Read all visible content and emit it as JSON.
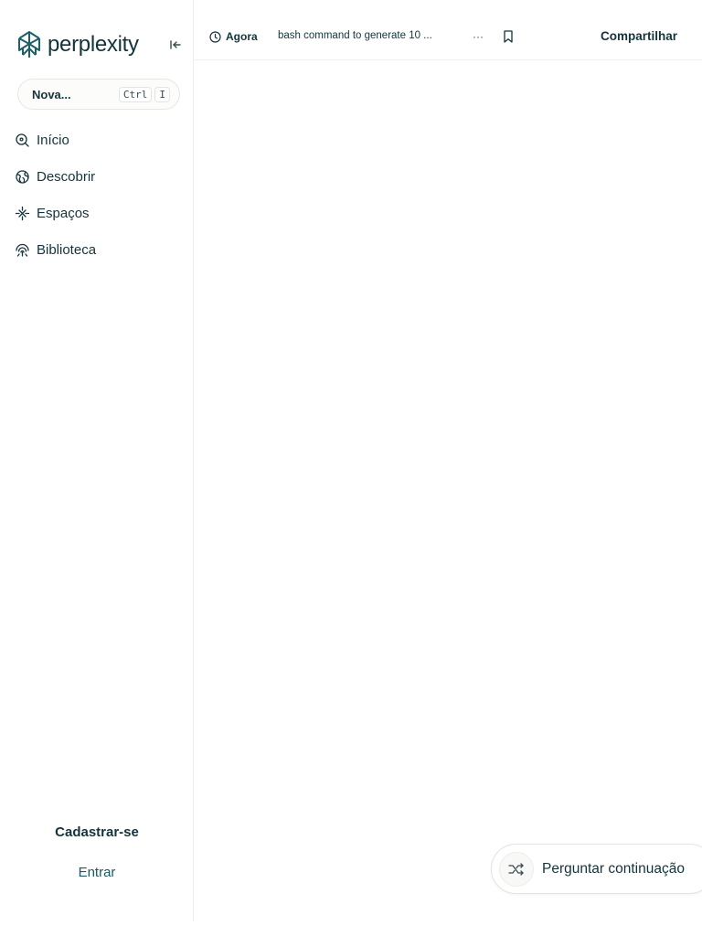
{
  "sidebar": {
    "brand": "perplexity",
    "new_thread": {
      "label": "Nova...",
      "shortcut": [
        "Ctrl",
        "I"
      ]
    },
    "items": [
      {
        "label": "Início",
        "icon": "search-icon"
      },
      {
        "label": "Descobrir",
        "icon": "globe-icon"
      },
      {
        "label": "Espaços",
        "icon": "sparkle-icon"
      },
      {
        "label": "Biblioteca",
        "icon": "library-icon"
      }
    ],
    "signup_label": "Cadastrar-se",
    "login_label": "Entrar"
  },
  "header": {
    "time": "Agora",
    "thread_title": "bash command to generate 10 ...",
    "more": "···",
    "share_label": "Compartilhar"
  },
  "followup": {
    "label": "Perguntar continuação"
  },
  "colors": {
    "brand": "#1f5f69",
    "text": "#13343b",
    "accent": "#1b5a63"
  }
}
